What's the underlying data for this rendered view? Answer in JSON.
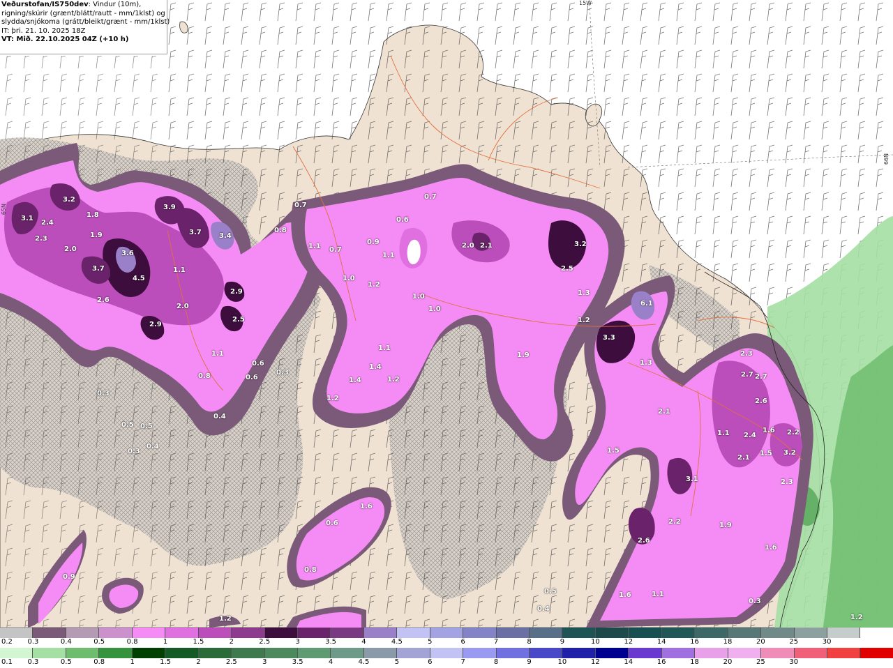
{
  "info": {
    "source": "Veðurstofan/IS750dev",
    "line1_rest": ": Vindur (10m),",
    "line2": "rigning/skúrir (grænt/blátt/rautt - mm/1klst) og",
    "line3": "slydda/snjókoma (grátt/bleikt/grænt - mm/1klst)",
    "init_time": "IT: þri. 21. 10. 2025 18Z",
    "valid_time": "VT: Mið. 22.10.2025 04Z (+10 h)"
  },
  "grid_labels": {
    "lon": "15W",
    "lat_right": "66N",
    "lat_left": "65N"
  },
  "colors": {
    "sea": "#ffffff",
    "land": "#f0e2d2",
    "snow_colorbar": [
      "#c4c4c4",
      "#7a5a78",
      "#b59ab3",
      "#cc91cc",
      "#f58cf5",
      "#e070e0",
      "#bb4ebb",
      "#8e3a8e",
      "#3d0d3d",
      "#6a236a",
      "#7a3a82",
      "#9a80c8",
      "#c2c2f5",
      "#a3a3e4",
      "#8383c8",
      "#6a70a4",
      "#586f8a",
      "#1f5454",
      "#1c4a4a",
      "#175050",
      "#205858",
      "#3c6868",
      "#587878",
      "#708a8a",
      "#8ca0a0",
      "#c5cccc",
      "#ffffff"
    ],
    "rain_colorbar": [
      "#d2f5d2",
      "#a4dfa4",
      "#6ebd6e",
      "#35923d",
      "#004000",
      "#145a24",
      "#2a6b3a",
      "#3f7a4e",
      "#4c8a5e",
      "#5e9a72",
      "#6e9a8a",
      "#8a9aa8",
      "#a3a3d6",
      "#c2c2f5",
      "#9a9af0",
      "#7070e0",
      "#4848c8",
      "#2020a8",
      "#000090",
      "#6a3ad0",
      "#a070e0",
      "#e8a0e8",
      "#f0b0f0",
      "#f08cb8",
      "#f06078",
      "#f04040",
      "#e00000"
    ]
  },
  "snow_scale_labels": [
    "0.2",
    "0.3",
    "0.4",
    "0.5",
    "0.8",
    "1",
    "1.5",
    "2",
    "2.5",
    "3",
    "3.5",
    "4",
    "4.5",
    "5",
    "6",
    "7",
    "8",
    "9",
    "10",
    "12",
    "14",
    "16",
    "18",
    "20",
    "25",
    "30"
  ],
  "rain_scale_labels": [
    "0.1",
    "0.3",
    "0.5",
    "0.8",
    "1",
    "1.5",
    "2",
    "2.5",
    "3",
    "3.5",
    "4",
    "4.5",
    "5",
    "6",
    "7",
    "8",
    "9",
    "10",
    "12",
    "14",
    "16",
    "18",
    "20",
    "25",
    "30"
  ],
  "value_labels": [
    {
      "t": "3.1"
    },
    {
      "t": "2.4"
    },
    {
      "t": "2.3"
    },
    {
      "t": "3.2"
    },
    {
      "t": "1.8"
    },
    {
      "t": "1.9"
    },
    {
      "t": "2.0"
    },
    {
      "t": "3.9"
    },
    {
      "t": "3.7"
    },
    {
      "t": "3.4"
    },
    {
      "t": "3.6"
    },
    {
      "t": "3.7"
    },
    {
      "t": "4.5"
    },
    {
      "t": "2.6"
    },
    {
      "t": "1.1"
    },
    {
      "t": "2.0"
    },
    {
      "t": "2.9"
    },
    {
      "t": "2.9"
    },
    {
      "t": "2.5"
    },
    {
      "t": "0.7"
    },
    {
      "t": "0.8"
    },
    {
      "t": "1.1"
    },
    {
      "t": "0.7"
    },
    {
      "t": "0.9"
    },
    {
      "t": "0.7"
    },
    {
      "t": "0.6"
    },
    {
      "t": "1.1"
    },
    {
      "t": "1.0"
    },
    {
      "t": "1.2"
    },
    {
      "t": "1.0"
    },
    {
      "t": "1.0"
    },
    {
      "t": "2.0"
    },
    {
      "t": "2.1"
    },
    {
      "t": "3.2"
    },
    {
      "t": "2.5"
    },
    {
      "t": "1.3"
    },
    {
      "t": "1.2"
    },
    {
      "t": "6.1"
    },
    {
      "t": "3.3"
    },
    {
      "t": "1.3"
    },
    {
      "t": "1.9"
    },
    {
      "t": "1.1"
    },
    {
      "t": "1.4"
    },
    {
      "t": "1.2"
    },
    {
      "t": "1.4"
    },
    {
      "t": "1.2"
    },
    {
      "t": "0.6"
    },
    {
      "t": "0.6"
    },
    {
      "t": "0.3"
    },
    {
      "t": "1.1"
    },
    {
      "t": "0.8"
    },
    {
      "t": "0.4"
    },
    {
      "t": "0.3"
    },
    {
      "t": "0.5"
    },
    {
      "t": "0.5"
    },
    {
      "t": "0.4"
    },
    {
      "t": "0.3"
    },
    {
      "t": "2.1"
    },
    {
      "t": "1.5"
    },
    {
      "t": "2.3"
    },
    {
      "t": "2.7"
    },
    {
      "t": "2.7"
    },
    {
      "t": "2.6"
    },
    {
      "t": "1.1"
    },
    {
      "t": "2.4"
    },
    {
      "t": "1.6"
    },
    {
      "t": "2.2"
    },
    {
      "t": "2.1"
    },
    {
      "t": "1.5"
    },
    {
      "t": "3.2"
    },
    {
      "t": "2.3"
    },
    {
      "t": "3.1"
    },
    {
      "t": "2.2"
    },
    {
      "t": "2.6"
    },
    {
      "t": "1.9"
    },
    {
      "t": "1.6"
    },
    {
      "t": "0.3"
    },
    {
      "t": "1.6"
    },
    {
      "t": "1.1"
    },
    {
      "t": "1.2"
    },
    {
      "t": "1.6"
    },
    {
      "t": "0.6"
    },
    {
      "t": "0.8"
    },
    {
      "t": "0.9"
    },
    {
      "t": "0.5"
    },
    {
      "t": "0.4"
    },
    {
      "t": "1.2"
    }
  ]
}
